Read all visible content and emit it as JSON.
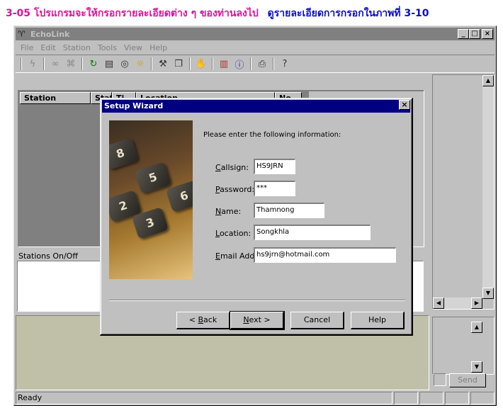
{
  "caption": {
    "part1": "3-05 โปรแกรมจะให้กรอกรายละเอียดต่าง ๆ ของท่านลงไป",
    "part2": "ดูรายละเอียดการกรอกในภาพที่ 3-10"
  },
  "window": {
    "title": "EchoLink",
    "controls": [
      "_",
      "□",
      "×"
    ]
  },
  "menu": [
    "File",
    "Edit",
    "Station",
    "Tools",
    "View",
    "Help"
  ],
  "toolbar_icons": [
    "lightning-icon",
    "link-icon",
    "unlink-icon",
    "refresh-icon",
    "info-page-icon",
    "binoculars-icon",
    "sun-icon",
    "tools-icon",
    "windows-icon",
    "hand-icon",
    "chart-icon",
    "info-icon",
    "printer-icon",
    "help-icon"
  ],
  "station_list": {
    "columns": [
      "Station",
      "Stat",
      "Ti",
      "Location",
      "No"
    ]
  },
  "stations_onoff_label": "Stations On/Off",
  "send_label": "Send",
  "status": {
    "text": "Ready"
  },
  "dialog": {
    "title": "Setup Wizard",
    "intro": "Please enter the following information:",
    "fields": [
      {
        "label_ul": "C",
        "label_rest": "allsign:",
        "value": "HS9JRN"
      },
      {
        "label_ul": "P",
        "label_rest": "assword:",
        "value": "***"
      },
      {
        "label_ul": "N",
        "label_rest": "ame:",
        "value": "Thamnong"
      },
      {
        "label_ul": "L",
        "label_rest": "ocation:",
        "value": "Songkhla"
      },
      {
        "label_ul": "E",
        "label_rest": "mail Addr:",
        "value": "hs9jrn@hotmail.com"
      }
    ],
    "buttons": {
      "back_prefix": "< ",
      "back_ul": "B",
      "back_rest": "ack",
      "next_ul": "N",
      "next_rest": "ext >",
      "cancel": "Cancel",
      "help": "Help"
    },
    "calc_keys": [
      "8",
      "5",
      "2",
      "3",
      "6"
    ]
  }
}
